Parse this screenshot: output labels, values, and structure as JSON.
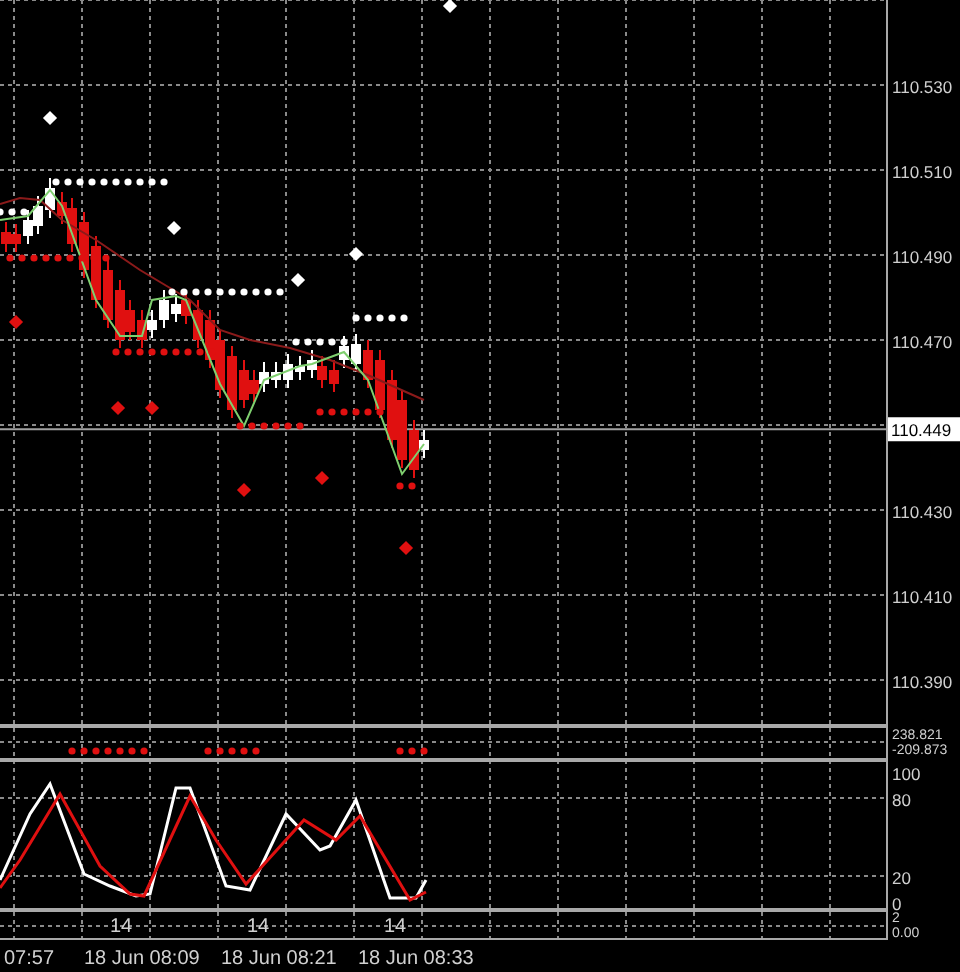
{
  "chart": {
    "price_axis": [
      "110.530",
      "110.510",
      "110.490",
      "110.470",
      "110.430",
      "110.410",
      "110.390"
    ],
    "current_price": "110.449",
    "indicator_1_axis": [
      "238.821",
      "-209.873"
    ],
    "stochastic_axis": [
      "100",
      "80",
      "20",
      "0"
    ],
    "indicator_3_axis": [
      "2",
      "0.00"
    ],
    "bar_labels": [
      "14",
      "14",
      "14"
    ],
    "time_axis": [
      "07:57",
      "18 Jun 08:09",
      "18 Jun 08:21",
      "18 Jun 08:33"
    ]
  }
}
